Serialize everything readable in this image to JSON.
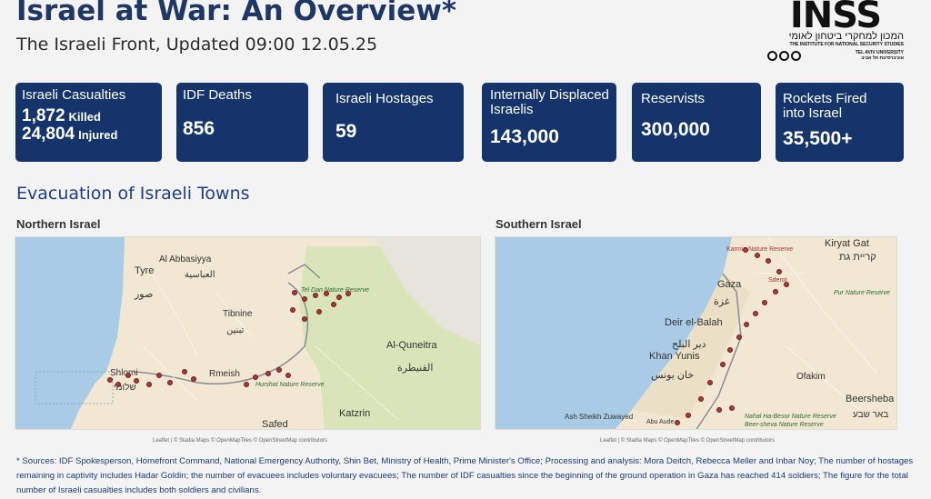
{
  "header": {
    "title": "Israel at War: An Overview*",
    "subtitle": "The Israeli Front, Updated 09:00 12.05.25"
  },
  "logo": {
    "mark": "INSS",
    "hebrew": "המכון למחקרי ביטחון לאומי",
    "english": "THE INSTITUTE FOR NATIONAL SECURITY STUDIES",
    "tau_he": "אוניברסיטת תל אביב",
    "tau_en": "TEL AVIV UNIVERSITY"
  },
  "stats": [
    {
      "label": "Israeli Casualties",
      "killed_value": "1,872",
      "killed_label": "Killed",
      "injured_value": "24,804",
      "injured_label": "Injured"
    },
    {
      "label": "IDF Deaths",
      "value": "856"
    },
    {
      "label": "Israeli Hostages",
      "value": "59"
    },
    {
      "label": "Internally Displaced Israelis",
      "value": "143,000"
    },
    {
      "label": "Reservists",
      "value": "300,000"
    },
    {
      "label": "Rockets Fired into Israel",
      "value": "35,500+"
    }
  ],
  "evacuation": {
    "title": "Evacuation of Israeli Towns",
    "north": {
      "title": "Northern Israel",
      "labels": {
        "tyre": "Tyre",
        "tyre_ar": "صور",
        "abbasiyya": "Al Abbasiyya",
        "abbasiyya_ar": "العباسية",
        "tibnine": "Tibnine",
        "tibnine_ar": "تبنين",
        "quneitra": "Al-Quneitra",
        "quneitra_ar": "القنيطرة",
        "shlomi": "Shlomi",
        "shlomi_he": "שלומי",
        "rmeish": "Rmeish",
        "safed": "Safed",
        "katzrin": "Katzrin",
        "tel_dan": "Tel Dan Nature Reserve",
        "hurshat": "Hurshat Nature Reserve"
      },
      "attribution": "Leaflet | © Stadia Maps © OpenMapTiles © OpenStreetMap contributors"
    },
    "south": {
      "title": "Southern Israel",
      "labels": {
        "kiryat_gat": "Kiryat Gat",
        "kiryat_gat_he": "קריית גת",
        "gaza": "Gaza",
        "gaza_ar": "غزة",
        "deir": "Deir el-Balah",
        "deir_ar": "دير البلح",
        "khan": "Khan Yunis",
        "khan_ar": "خان يونس",
        "ofakim": "Ofakim",
        "beersheba": "Beersheba",
        "beersheba_he": "באר שבע",
        "sderot": "Sderot",
        "karmia": "Karmia Nature Reserve",
        "poriya": "Pur Nature Reserve",
        "nahal": "Nahal Ha-Besor Nature Reserve",
        "beer_sheva_nr": "Beer-sheva Nature Reserve",
        "sheikh": "Ash Sheikh Zuwayed",
        "abu": "Abu Aude"
      },
      "attribution": "Leaflet | © Stadia Maps © OpenMapTiles © OpenStreetMap contributors"
    }
  },
  "footnote": "* Sources: IDF Spokesperson, Homefront Command, National Emergency Authority, Shin Bet, Ministry of Health, Prime Minister's Office; Processing and analysis: Mora Deitch, Rebecca Meller and Inbar Noy; The number of hostages remaining in captivity includes Hadar Goldin; the number of evacuees includes voluntary evacuees; The number of IDF casualties since the beginning of the ground operation in Gaza has reached 414 soldiers; The figure for the total number of Israeli casualties includes both soldiers and civilians.",
  "colors": {
    "primary": "#14346b",
    "dot": "#a53a3a"
  }
}
